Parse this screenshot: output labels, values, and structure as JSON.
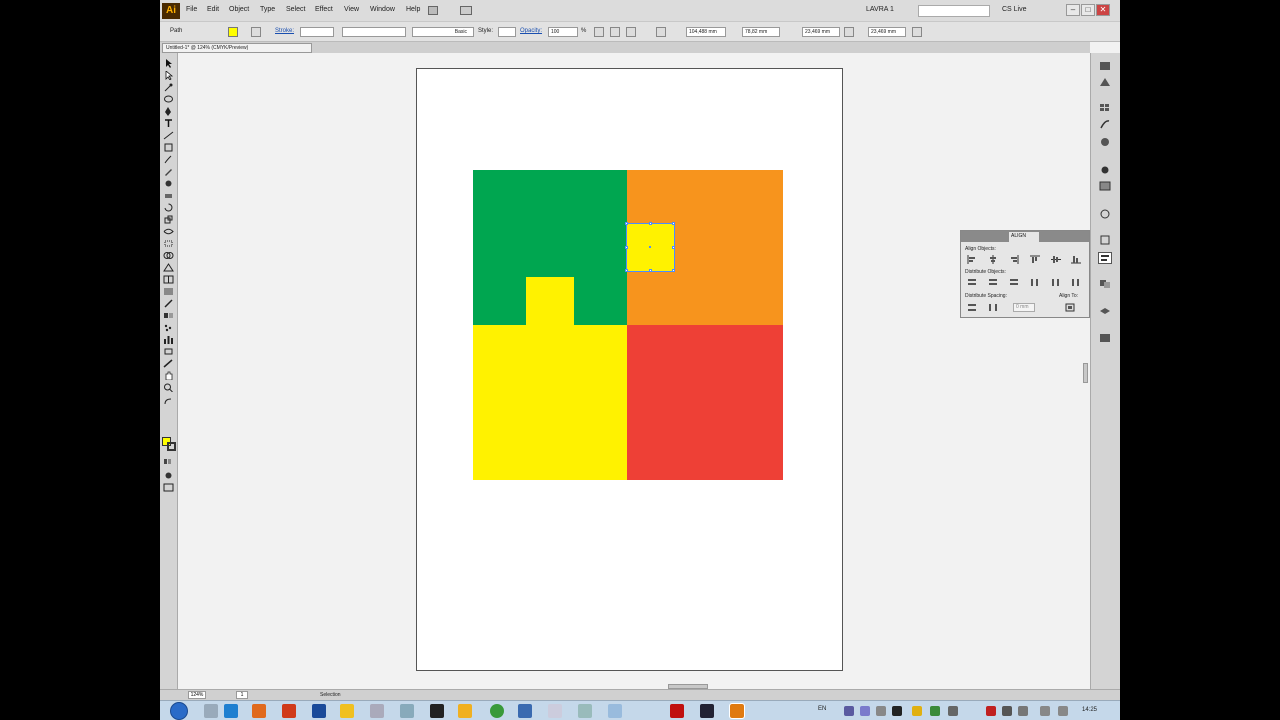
{
  "menubar": {
    "logo": "Ai",
    "menus": [
      "File",
      "Edit",
      "Object",
      "Type",
      "Select",
      "Effect",
      "View",
      "Window",
      "Help"
    ],
    "workspace": "LAVRA 1",
    "cs_live": "CS Live",
    "window_controls": {
      "minimize": "–",
      "maximize": "□",
      "close": "✕"
    }
  },
  "control_bar": {
    "object_label": "Path",
    "fill_color": "#ffff00",
    "stroke_label": "Stroke:",
    "brush_label": "Basic",
    "style_label": "Style:",
    "opacity_label": "Opacity:",
    "opacity_value": "100",
    "opacity_unit": "%",
    "x_value": "104,488 mm",
    "y_value": "78,82 mm",
    "w_value": "23,469 mm",
    "h_value": "23,469 mm"
  },
  "document_tab": {
    "label": "Untitled-1* @ 124% (CMYK/Preview)"
  },
  "canvas": {
    "shapes": [
      {
        "name": "green-square",
        "color": "#00a650"
      },
      {
        "name": "orange-square",
        "color": "#f7941d"
      },
      {
        "name": "yellow-square",
        "color": "#fff200"
      },
      {
        "name": "red-square",
        "color": "#ee4036"
      },
      {
        "name": "yellow-tab",
        "color": "#fff200"
      },
      {
        "name": "selected-yellow-small",
        "color": "#fff200"
      }
    ],
    "selection_color": "#4d8cff"
  },
  "align_panel": {
    "tabs": [
      "",
      "ALIGN",
      ""
    ],
    "align_objects": "Align Objects:",
    "distribute_objects": "Distribute Objects:",
    "distribute_spacing": "Distribute Spacing:",
    "align_to": "Align To:",
    "spacing_value": "0 mm"
  },
  "status_bar": {
    "zoom": "124%",
    "page": "1",
    "current_tool": "Selection"
  },
  "taskbar": {
    "language": "EN",
    "clock": "14:25"
  }
}
